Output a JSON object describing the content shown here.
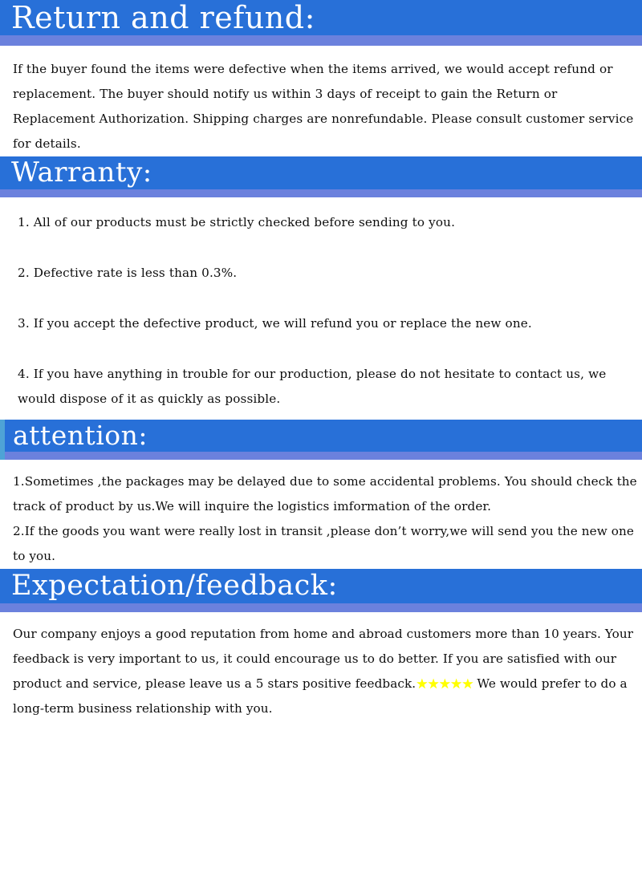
{
  "document": {
    "background_color": "#ffffff",
    "banner_color": "#2870d8",
    "banner_strip_color": "#6b81dd",
    "banner_text_color": "#ffffff",
    "body_text_color": "#0d0d0d",
    "star_color": "#ffff00",
    "attention_left_edge_color": "#4ea3d6"
  },
  "sections": {
    "return_refund": {
      "heading": "Return and refund:",
      "paragraph": "If the buyer found the items were defective when the items arrived, we would accept refund or replacement. The buyer should notify us within 3 days of receipt to gain the Return or Replacement Authorization. Shipping charges are nonrefundable. Please consult customer service for details."
    },
    "warranty": {
      "heading": "Warranty:",
      "items": [
        "1. All of our products must be strictly checked before sending to you.",
        "2. Defective rate is less than 0.3%.",
        "3. If you accept the defective product, we will refund you or replace the new one.",
        "4. If you have anything in trouble for our production, please do not hesitate to contact us, we would dispose of it as quickly as possible."
      ]
    },
    "attention": {
      "heading": "attention:",
      "items": [
        "1.Sometimes ,the packages may be delayed due to some accidental problems. You should check the track of product by us.We will inquire the logistics imformation of the order.",
        "2.If the goods you want were really lost in transit ,please don’t worry,we will send you the new one to you."
      ]
    },
    "expectation_feedback": {
      "heading": "Expectation/feedback:",
      "text_before_stars": "Our company enjoys a good reputation from home and abroad customers more than 10 years. Your feedback is very important to us, it could encourage us to do better. If you are satisfied with our product and service, please leave us a 5 stars positive feedback.",
      "stars": "★★★★★",
      "star_count": 5,
      "text_after_stars": " We would prefer to do a long-term business relationship with you."
    }
  }
}
